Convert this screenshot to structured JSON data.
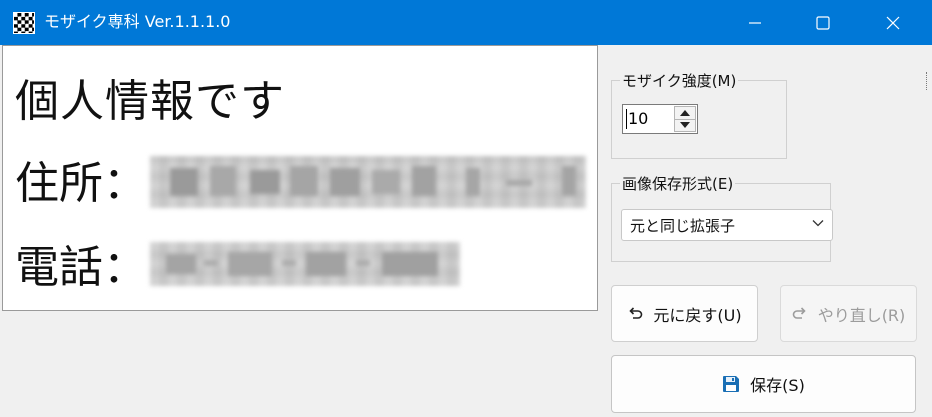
{
  "window": {
    "title": "モザイク専科 Ver.1.1.1.0",
    "icon": "checker-app-icon",
    "titlebar_color": "#0078d7"
  },
  "canvas": {
    "line1": "個人情報です",
    "line2_label": "住所：",
    "line3_label": "電話："
  },
  "strength": {
    "label": "モザイク強度(M)",
    "value": "10"
  },
  "format": {
    "label": "画像保存形式(E)",
    "selected": "元と同じ拡張子"
  },
  "buttons": {
    "undo": "元に戻す(U)",
    "redo": "やり直し(R)",
    "save": "保存(S)"
  },
  "colors": {
    "accent": "#0078d7",
    "save_icon": "#1a6fb5",
    "disabled_text": "#9c9c9c"
  }
}
